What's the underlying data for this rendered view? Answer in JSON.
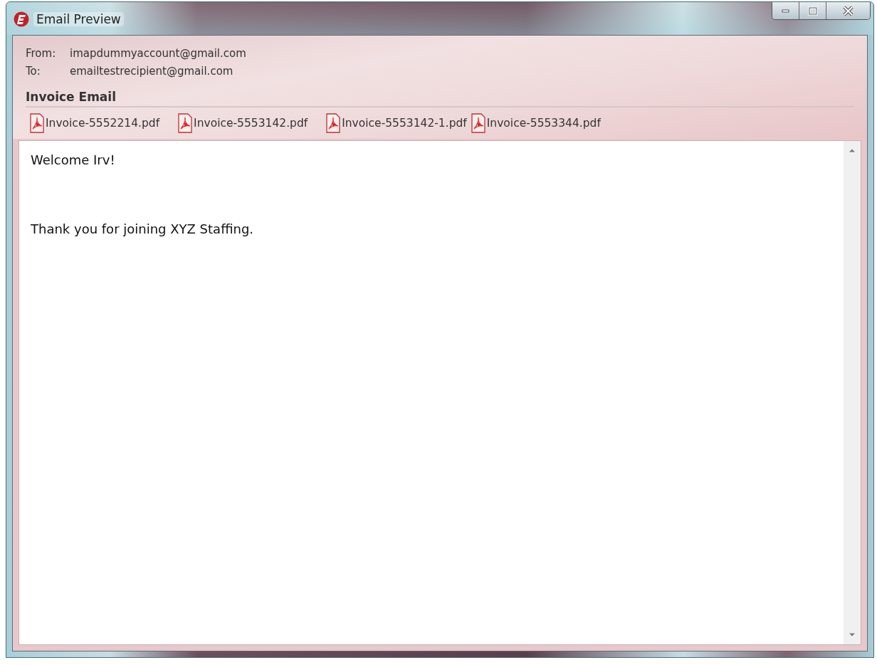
{
  "window": {
    "title": "Email Preview",
    "controls": [
      {
        "kind": "minimize"
      },
      {
        "kind": "maximize"
      },
      {
        "kind": "close"
      }
    ]
  },
  "header": {
    "from_label": "From:",
    "from": "imapdummyaccount@gmail.com",
    "to_label": "To:",
    "to": "emailtestrecipient@gmail.com",
    "subject": "Invoice Email"
  },
  "attachments": [
    {
      "name": "Invoice-5552214.pdf"
    },
    {
      "name": "Invoice-5553142.pdf"
    },
    {
      "name": "Invoice-5553142-1.pdf"
    },
    {
      "name": "Invoice-5553344.pdf"
    }
  ],
  "body": {
    "paragraphs": [
      "Welcome Irv!",
      "Thank you for joining XYZ Staffing."
    ]
  }
}
